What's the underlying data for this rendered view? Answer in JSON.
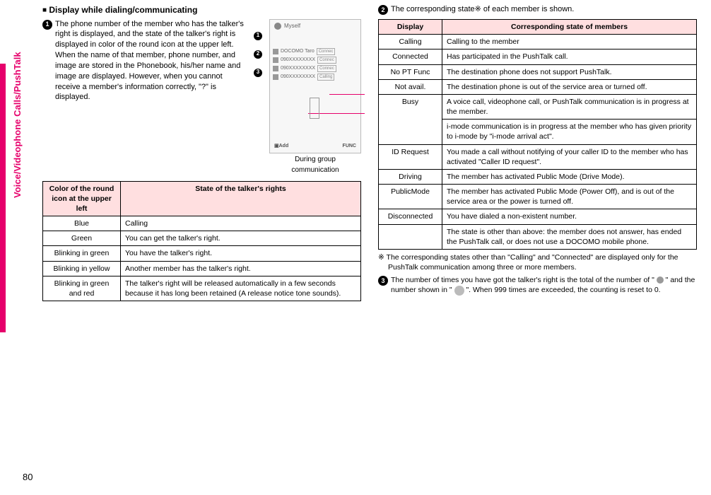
{
  "sideTab": "Voice/Videophone Calls/PushTalk",
  "pageNumber": "80",
  "left": {
    "heading": "Display while dialing/communicating",
    "item1": {
      "num": "1",
      "text": "The phone number of the member who has the talker's right is displayed, and the state of the talker's right is displayed in color of the round icon at the upper left. When the name of that member, phone number, and image are stored in the Phonebook, his/her name and image are displayed. However, when you cannot receive a member's information correctly, \"?\" is displayed."
    },
    "phone": {
      "myself": "Myself",
      "rows": [
        {
          "name": "DOCOMO Taro",
          "tag": "Connec"
        },
        {
          "name": "090XXXXXXXX",
          "tag": "Connec"
        },
        {
          "name": "090XXXXXXXX",
          "tag": "Connec"
        },
        {
          "name": "090XXXXXXXX",
          "tag": "Calling"
        }
      ],
      "btnLeft": "Add",
      "btnRight": "FUNC",
      "caption1": "During group",
      "caption2": "communication",
      "call1": "1",
      "call2": "2",
      "call3": "3"
    },
    "table1": {
      "h1": "Color of the round icon at the upper left",
      "h2": "State of the talker's rights",
      "rows": [
        {
          "c1": "Blue",
          "c2": "Calling"
        },
        {
          "c1": "Green",
          "c2": "You can get the talker's right."
        },
        {
          "c1": "Blinking in green",
          "c2": "You have the talker's right."
        },
        {
          "c1": "Blinking in yellow",
          "c2": "Another member has the talker's right."
        },
        {
          "c1": "Blinking in green and red",
          "c2": "The talker's right will be released automatically in a few seconds because it has long been retained (A release notice tone sounds)."
        }
      ]
    }
  },
  "right": {
    "item2": {
      "num": "2",
      "textA": "The corresponding state",
      "textB": " of each member is shown."
    },
    "table2": {
      "h1": "Display",
      "h2": "Corresponding state of members",
      "rows": [
        {
          "c1": "Calling",
          "c2": "Calling to the member"
        },
        {
          "c1": "Connected",
          "c2": "Has participated in the PushTalk call."
        },
        {
          "c1": "No PT Func",
          "c2": "The destination phone does not support PushTalk."
        },
        {
          "c1": "Not avail.",
          "c2": "The destination phone is out of the service area or turned off."
        },
        {
          "c1": "Busy",
          "c2": "A voice call, videophone call, or PushTalk communication is in progress at the member."
        },
        {
          "c1": "",
          "c2": "i-mode communication is in progress at the member who has given priority to i-mode by \"i-mode arrival act\"."
        },
        {
          "c1": "ID Request",
          "c2": "You made a call without notifying of your caller ID to the member who has activated \"Caller ID request\"."
        },
        {
          "c1": "Driving",
          "c2": "The member has activated Public Mode (Drive Mode)."
        },
        {
          "c1": "PublicMode",
          "c2": "The member has activated Public Mode (Power Off), and is out of the service area or the power is turned off."
        },
        {
          "c1": "Disconnected",
          "c2": "You have dialed a non-existent number."
        },
        {
          "c1": "",
          "c2": "The state is other than above: the member does not answer, has ended the PushTalk call, or does not use a DOCOMO mobile phone."
        }
      ]
    },
    "note": "※ The corresponding states other than \"Calling\" and \"Connected\" are displayed only for the PushTalk communication among three or more members.",
    "item3": {
      "num": "3",
      "textA": "The number of times you have got the talker's right is the total of the number of \" ",
      "textB": " \" and the number shown in \" ",
      "textC": " \". When 999 times are exceeded, the counting is reset to 0."
    }
  }
}
